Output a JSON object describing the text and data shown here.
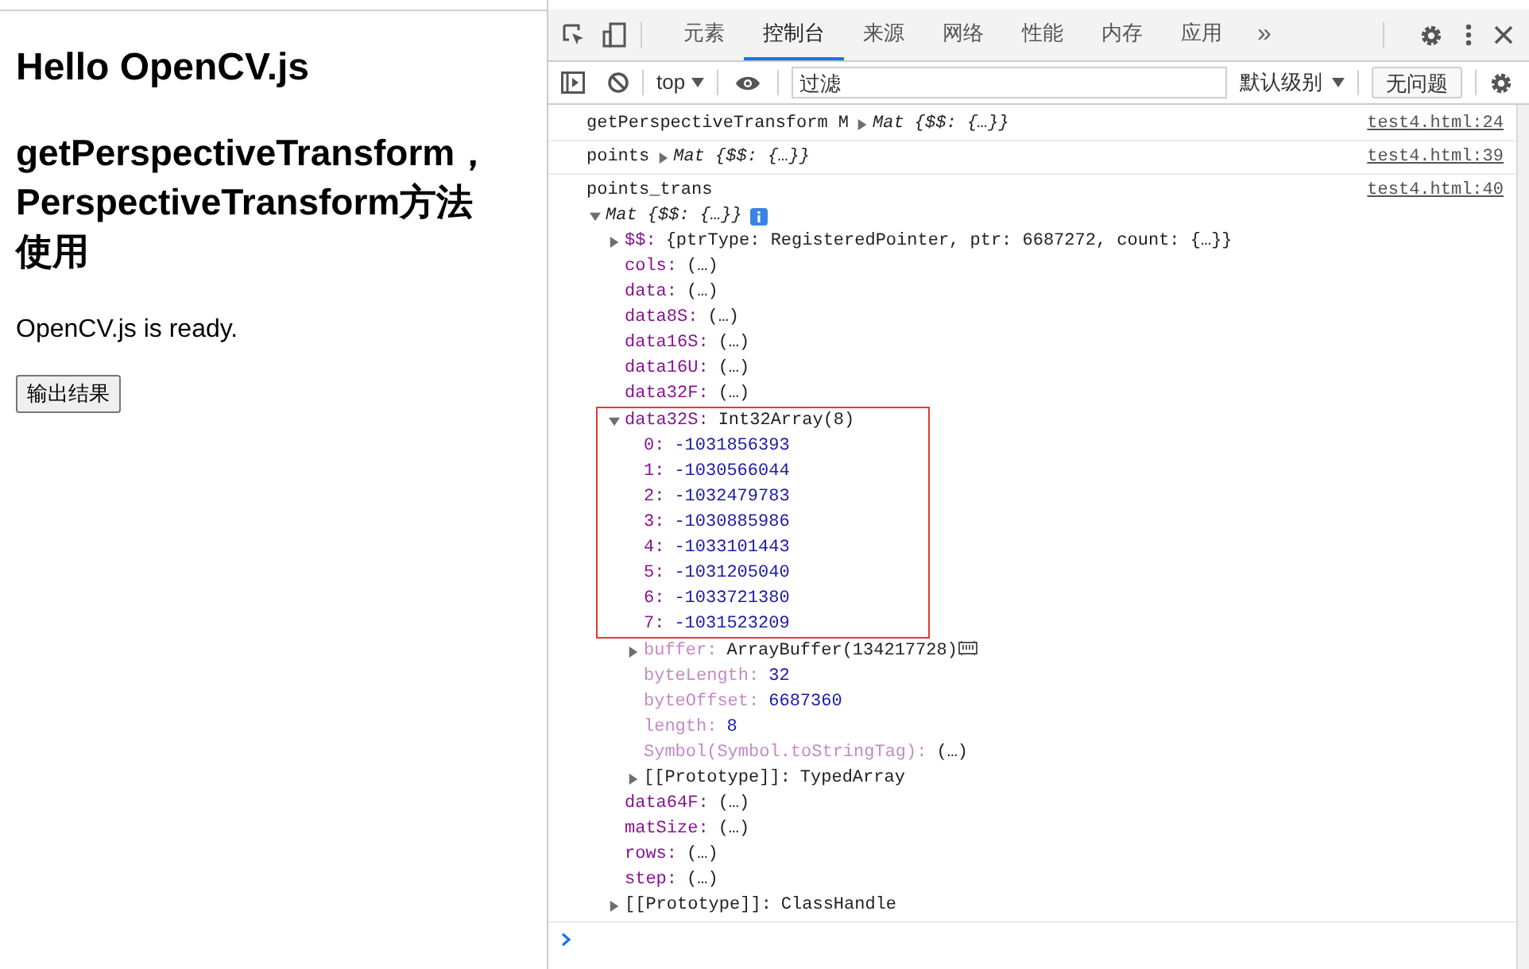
{
  "page": {
    "heading": "Hello OpenCV.js",
    "subheading": "getPerspectiveTransform，PerspectiveTransform方法使用",
    "status": "OpenCV.js is ready.",
    "button": "输出结果"
  },
  "devtools": {
    "tabs": [
      {
        "label": "元素",
        "selected": false
      },
      {
        "label": "控制台",
        "selected": true
      },
      {
        "label": "来源",
        "selected": false
      },
      {
        "label": "网络",
        "selected": false
      },
      {
        "label": "性能",
        "selected": false
      },
      {
        "label": "内存",
        "selected": false
      },
      {
        "label": "应用",
        "selected": false
      }
    ],
    "more_tabs": "»",
    "console_toolbar": {
      "context": "top",
      "filter": {
        "placeholder": "过滤"
      },
      "level": "默认级别",
      "issues": "无问题"
    },
    "entries": [
      {
        "message": "getPerspectiveTransform M",
        "object": {
          "summary": "Mat {$$: {…}}",
          "expanded": false
        },
        "source": "test4.html:24"
      },
      {
        "message": "points",
        "object": {
          "summary": "Mat {$$: {…}}",
          "expanded": false
        },
        "source": "test4.html:39"
      },
      {
        "message": "points_trans",
        "object": {
          "summary": "Mat {$$: {…}}",
          "expanded": true,
          "children": [
            {
              "key": "$$:",
              "value": "{ptrType: RegisteredPointer, ptr: 6687272, count: {…}}",
              "kind": "own",
              "numeric": false,
              "expanded": false
            },
            {
              "key": "cols:",
              "value": "(…)",
              "kind": "own",
              "numeric": false
            },
            {
              "key": "data:",
              "value": "(…)",
              "kind": "own",
              "numeric": false
            },
            {
              "key": "data8S:",
              "value": "(…)",
              "kind": "own",
              "numeric": false
            },
            {
              "key": "data16S:",
              "value": "(…)",
              "kind": "own",
              "numeric": false
            },
            {
              "key": "data16U:",
              "value": "(…)",
              "kind": "own",
              "numeric": false
            },
            {
              "key": "data32F:",
              "value": "(…)",
              "kind": "own",
              "numeric": false
            },
            {
              "key": "data32S:",
              "value": "Int32Array(8)",
              "kind": "own",
              "numeric": false,
              "expanded": true,
              "highlighted": true,
              "children": [
                {
                  "key": "0:",
                  "value": "-1031856393",
                  "kind": "own",
                  "numeric": true
                },
                {
                  "key": "1:",
                  "value": "-1030566044",
                  "kind": "own",
                  "numeric": true
                },
                {
                  "key": "2:",
                  "value": "-1032479783",
                  "kind": "own",
                  "numeric": true
                },
                {
                  "key": "3:",
                  "value": "-1030885986",
                  "kind": "own",
                  "numeric": true
                },
                {
                  "key": "4:",
                  "value": "-1033101443",
                  "kind": "own",
                  "numeric": true
                },
                {
                  "key": "5:",
                  "value": "-1031205040",
                  "kind": "own",
                  "numeric": true
                },
                {
                  "key": "6:",
                  "value": "-1033721380",
                  "kind": "own",
                  "numeric": true
                },
                {
                  "key": "7:",
                  "value": "-1031523209",
                  "kind": "own",
                  "numeric": true
                },
                {
                  "key": "buffer:",
                  "value": "ArrayBuffer(134217728)",
                  "kind": "inherited",
                  "numeric": false,
                  "expanded": false,
                  "inspectable": true
                },
                {
                  "key": "byteLength:",
                  "value": "32",
                  "kind": "inherited",
                  "numeric": true
                },
                {
                  "key": "byteOffset:",
                  "value": "6687360",
                  "kind": "inherited",
                  "numeric": true
                },
                {
                  "key": "length:",
                  "value": "8",
                  "kind": "inherited",
                  "numeric": true
                },
                {
                  "key": "Symbol(Symbol.toStringTag):",
                  "value": "(…)",
                  "kind": "inherited",
                  "numeric": false
                },
                {
                  "key": "[[Prototype]]:",
                  "value": "TypedArray",
                  "kind": "internal",
                  "numeric": false,
                  "expanded": false
                }
              ]
            },
            {
              "key": "data64F:",
              "value": "(…)",
              "kind": "own",
              "numeric": false
            },
            {
              "key": "matSize:",
              "value": "(…)",
              "kind": "own",
              "numeric": false
            },
            {
              "key": "rows:",
              "value": "(…)",
              "kind": "own",
              "numeric": false
            },
            {
              "key": "step:",
              "value": "(…)",
              "kind": "own",
              "numeric": false
            },
            {
              "key": "[[Prototype]]:",
              "value": "ClassHandle",
              "kind": "internal",
              "numeric": false,
              "expanded": false
            }
          ]
        },
        "source": "test4.html:40"
      }
    ]
  }
}
